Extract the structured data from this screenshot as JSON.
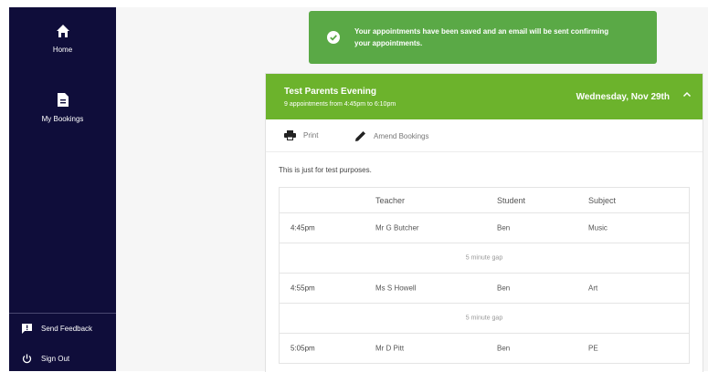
{
  "sidebar": {
    "home_label": "Home",
    "bookings_label": "My Bookings",
    "feedback_label": "Send Feedback",
    "signout_label": "Sign Out"
  },
  "alert": {
    "message": "Your appointments have been saved and an email will be sent confirming your appointments."
  },
  "event": {
    "title": "Test Parents Evening",
    "subtitle": "9 appointments from 4:45pm to 6:10pm",
    "date": "Wednesday, Nov 29th",
    "print_label": "Print",
    "amend_label": "Amend Bookings",
    "description": "This is just for test purposes."
  },
  "table": {
    "headers": {
      "teacher": "Teacher",
      "student": "Student",
      "subject": "Subject"
    },
    "rows": [
      {
        "time": "4:45pm",
        "teacher": "Mr G Butcher",
        "student": "Ben",
        "subject": "Music"
      },
      {
        "gap": "5 minute gap"
      },
      {
        "time": "4:55pm",
        "teacher": "Ms S Howell",
        "student": "Ben",
        "subject": "Art"
      },
      {
        "gap": "5 minute gap"
      },
      {
        "time": "5:05pm",
        "teacher": "Mr D Pitt",
        "student": "Ben",
        "subject": "PE"
      }
    ]
  },
  "colors": {
    "sidebar_bg": "#0f0d3a",
    "alert_bg": "#5aa946",
    "header_bg": "#6cb32c"
  },
  "icons": [
    "home-icon",
    "document-icon",
    "feedback-icon",
    "power-icon",
    "check-circle-icon",
    "chevron-up-icon",
    "printer-icon",
    "pencil-icon"
  ]
}
